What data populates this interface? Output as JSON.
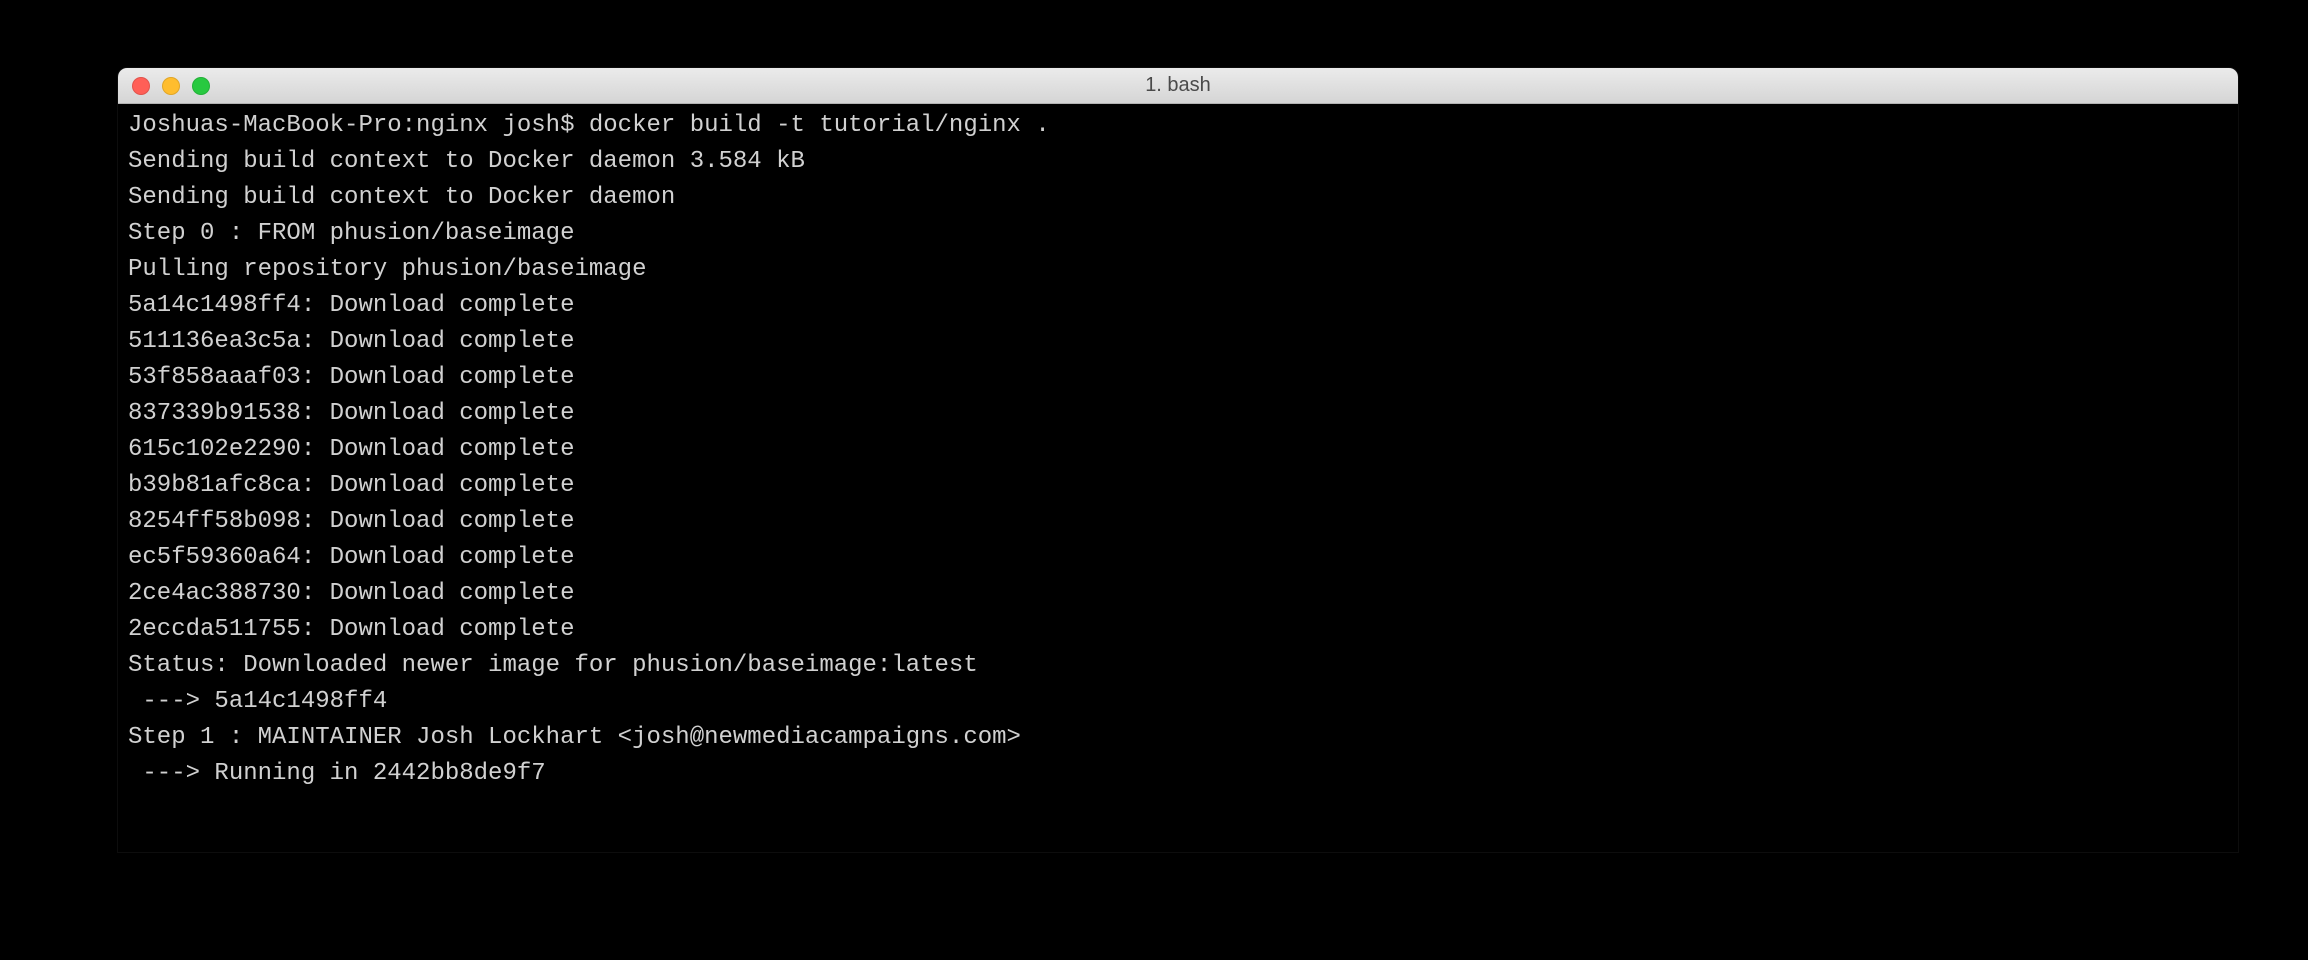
{
  "window": {
    "title": "1. bash"
  },
  "prompt": {
    "text": "Joshuas-MacBook-Pro:nginx josh$ ",
    "command": "docker build -t tutorial/nginx ."
  },
  "output": {
    "lines": [
      "Sending build context to Docker daemon 3.584 kB",
      "Sending build context to Docker daemon ",
      "Step 0 : FROM phusion/baseimage",
      "Pulling repository phusion/baseimage",
      "5a14c1498ff4: Download complete ",
      "511136ea3c5a: Download complete ",
      "53f858aaaf03: Download complete ",
      "837339b91538: Download complete ",
      "615c102e2290: Download complete ",
      "b39b81afc8ca: Download complete ",
      "8254ff58b098: Download complete ",
      "ec5f59360a64: Download complete ",
      "2ce4ac388730: Download complete ",
      "2eccda511755: Download complete ",
      "Status: Downloaded newer image for phusion/baseimage:latest",
      " ---> 5a14c1498ff4",
      "Step 1 : MAINTAINER Josh Lockhart <josh@newmediacampaigns.com>",
      " ---> Running in 2442bb8de9f7"
    ]
  }
}
